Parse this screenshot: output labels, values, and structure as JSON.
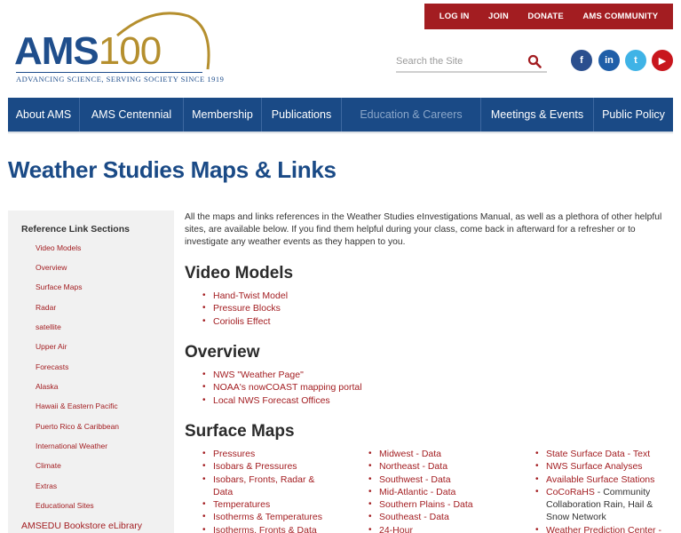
{
  "brand": {
    "logo_main": "AMS",
    "logo_number": "100",
    "tagline": "ADVANCING SCIENCE, SERVING SOCIETY SINCE 1919",
    "primary_color": "#1a4a86",
    "accent_color": "#a31d21"
  },
  "topbar": {
    "login": "LOG IN",
    "join": "JOIN",
    "donate": "DONATE",
    "community": "AMS COMMUNITY"
  },
  "search": {
    "placeholder": "Search the Site",
    "icon": "search-icon"
  },
  "social": {
    "facebook": "f",
    "linkedin": "in",
    "twitter": "t",
    "youtube": "▶"
  },
  "nav": {
    "items": [
      {
        "label": "About AMS"
      },
      {
        "label": "AMS Centennial"
      },
      {
        "label": "Membership"
      },
      {
        "label": "Publications"
      },
      {
        "label": "Education & Careers"
      },
      {
        "label": "Meetings & Events"
      },
      {
        "label": "Public Policy"
      }
    ]
  },
  "page": {
    "title": "Weather Studies Maps & Links"
  },
  "sidebar": {
    "heading": "Reference Link Sections",
    "items": [
      "Video Models",
      "Overview",
      "Surface Maps",
      "Radar",
      "satellite",
      "Upper Air",
      "Forecasts",
      "Alaska",
      "Hawaii & Eastern Pacific",
      "Puerto Rico & Caribbean",
      "International Weather",
      "Climate",
      "Extras",
      "Educational Sites"
    ],
    "footer": "AMSEDU Bookstore eLibrary"
  },
  "content": {
    "intro": "All the maps and links references in the Weather Studies eInvestigations Manual, as well as a plethora of other helpful sites, are available below. If you find them helpful during your class, come back in afterward for a refresher or to investigate any weather events as they happen to you.",
    "video_models": {
      "title": "Video Models",
      "links": [
        "Hand-Twist Model",
        "Pressure Blocks",
        "Coriolis Effect"
      ]
    },
    "overview": {
      "title": "Overview",
      "links": [
        "NWS \"Weather Page\"",
        "NOAA's nowCOAST mapping portal",
        "Local NWS Forecast Offices"
      ]
    },
    "surface_maps": {
      "title": "Surface Maps",
      "col1": [
        "Pressures",
        "Isobars & Pressures",
        "Isobars, Fronts, Radar &",
        "Data",
        "Temperatures",
        "Isotherms & Temperatures",
        "Isotherms, Fronts & Data"
      ],
      "col2": [
        " Midwest - Data",
        "Northeast - Data",
        "Southwest - Data",
        "Mid-Atlantic - Data",
        "Southern Plains - Data",
        "Southeast - Data",
        "24-Hour"
      ],
      "col3": [
        "State Surface Data - Text",
        "NWS Surface Analyses",
        "Available Surface Stations"
      ],
      "cocorahs_link": "CoCoRaHS",
      "cocorahs_text": " - Community",
      "cocorahs_line2": "Collaboration Rain, Hail &",
      "cocorahs_line3": "Snow Network",
      "wpc": "Weather Prediction Center -"
    }
  }
}
